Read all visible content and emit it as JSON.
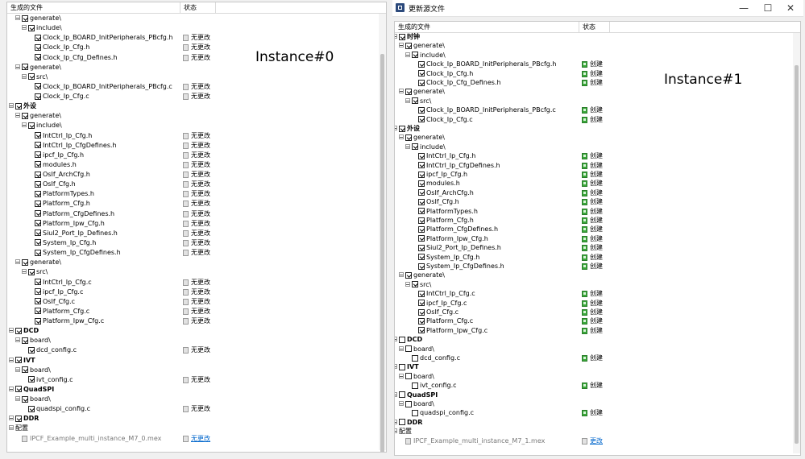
{
  "window1": {
    "title": "更新源文件",
    "minimize_glyph": "—",
    "maximize_glyph": "☐",
    "close_glyph": "✕"
  },
  "columns": {
    "file": "生成的文件",
    "status": "状态"
  },
  "panels": [
    {
      "caption": "Instance#0",
      "rows": [
        {
          "level": 1,
          "label": "generate\\",
          "checked": true
        },
        {
          "level": 2,
          "label": "include\\",
          "checked": true
        },
        {
          "level": 3,
          "label": "Clock_Ip_BOARD_InitPeripherals_PBcfg.h",
          "checked": true,
          "status": "无更改"
        },
        {
          "level": 3,
          "label": "Clock_Ip_Cfg.h",
          "checked": true,
          "status": "无更改"
        },
        {
          "level": 3,
          "label": "Clock_Ip_Cfg_Defines.h",
          "checked": true,
          "status": "无更改"
        },
        {
          "level": 1,
          "label": "generate\\",
          "checked": true
        },
        {
          "level": 2,
          "label": "src\\",
          "checked": true
        },
        {
          "level": 3,
          "label": "Clock_Ip_BOARD_InitPeripherals_PBcfg.c",
          "checked": true,
          "status": "无更改"
        },
        {
          "level": 3,
          "label": "Clock_Ip_Cfg.c",
          "checked": true,
          "status": "无更改"
        },
        {
          "level": 0,
          "label": "外设",
          "checked": true,
          "bold": true
        },
        {
          "level": 1,
          "label": "generate\\",
          "checked": true
        },
        {
          "level": 2,
          "label": "include\\",
          "checked": true
        },
        {
          "level": 3,
          "label": "IntCtrl_Ip_Cfg.h",
          "checked": true,
          "status": "无更改"
        },
        {
          "level": 3,
          "label": "IntCtrl_Ip_CfgDefines.h",
          "checked": true,
          "status": "无更改"
        },
        {
          "level": 3,
          "label": "ipcf_Ip_Cfg.h",
          "checked": true,
          "status": "无更改"
        },
        {
          "level": 3,
          "label": "modules.h",
          "checked": true,
          "status": "无更改"
        },
        {
          "level": 3,
          "label": "OsIf_ArchCfg.h",
          "checked": true,
          "status": "无更改"
        },
        {
          "level": 3,
          "label": "OsIf_Cfg.h",
          "checked": true,
          "status": "无更改"
        },
        {
          "level": 3,
          "label": "PlatformTypes.h",
          "checked": true,
          "status": "无更改"
        },
        {
          "level": 3,
          "label": "Platform_Cfg.h",
          "checked": true,
          "status": "无更改"
        },
        {
          "level": 3,
          "label": "Platform_CfgDefines.h",
          "checked": true,
          "status": "无更改"
        },
        {
          "level": 3,
          "label": "Platform_Ipw_Cfg.h",
          "checked": true,
          "status": "无更改"
        },
        {
          "level": 3,
          "label": "Siul2_Port_Ip_Defines.h",
          "checked": true,
          "status": "无更改"
        },
        {
          "level": 3,
          "label": "System_Ip_Cfg.h",
          "checked": true,
          "status": "无更改"
        },
        {
          "level": 3,
          "label": "System_Ip_CfgDefines.h",
          "checked": true,
          "status": "无更改"
        },
        {
          "level": 1,
          "label": "generate\\",
          "checked": true
        },
        {
          "level": 2,
          "label": "src\\",
          "checked": true
        },
        {
          "level": 3,
          "label": "IntCtrl_Ip_Cfg.c",
          "checked": true,
          "status": "无更改"
        },
        {
          "level": 3,
          "label": "ipcf_Ip_Cfg.c",
          "checked": true,
          "status": "无更改"
        },
        {
          "level": 3,
          "label": "OsIf_Cfg.c",
          "checked": true,
          "status": "无更改"
        },
        {
          "level": 3,
          "label": "Platform_Cfg.c",
          "checked": true,
          "status": "无更改"
        },
        {
          "level": 3,
          "label": "Platform_Ipw_Cfg.c",
          "checked": true,
          "status": "无更改"
        },
        {
          "level": 0,
          "label": "DCD",
          "checked": true,
          "bold": true
        },
        {
          "level": 1,
          "label": "board\\",
          "checked": true
        },
        {
          "level": 2,
          "label": "dcd_config.c",
          "checked": true,
          "status": "无更改"
        },
        {
          "level": 0,
          "label": "IVT",
          "checked": true,
          "bold": true
        },
        {
          "level": 1,
          "label": "board\\",
          "checked": true
        },
        {
          "level": 2,
          "label": "ivt_config.c",
          "checked": true,
          "status": "无更改"
        },
        {
          "level": 0,
          "label": "QuadSPI",
          "checked": true,
          "bold": true
        },
        {
          "level": 1,
          "label": "board\\",
          "checked": true
        },
        {
          "level": 2,
          "label": "quadspi_config.c",
          "checked": true,
          "status": "无更改"
        },
        {
          "level": 0,
          "label": "DDR",
          "checked": true,
          "bold": true
        },
        {
          "level": 0,
          "label": "配置",
          "nocheck": true
        },
        {
          "level": 1,
          "label": "IPCF_Example_multi_instance_M7_0.mex",
          "gray": true,
          "status": "无更改",
          "status_link": true
        }
      ]
    },
    {
      "caption": "Instance#1",
      "rows": [
        {
          "level": 0,
          "label": "时钟",
          "checked": true,
          "bold": true
        },
        {
          "level": 1,
          "label": "generate\\",
          "checked": true
        },
        {
          "level": 2,
          "label": "include\\",
          "checked": true
        },
        {
          "level": 3,
          "label": "Clock_Ip_BOARD_InitPeripherals_PBcfg.h",
          "checked": true,
          "status": "创建"
        },
        {
          "level": 3,
          "label": "Clock_Ip_Cfg.h",
          "checked": true,
          "status": "创建"
        },
        {
          "level": 3,
          "label": "Clock_Ip_Cfg_Defines.h",
          "checked": true,
          "status": "创建"
        },
        {
          "level": 1,
          "label": "generate\\",
          "checked": true
        },
        {
          "level": 2,
          "label": "src\\",
          "checked": true
        },
        {
          "level": 3,
          "label": "Clock_Ip_BOARD_InitPeripherals_PBcfg.c",
          "checked": true,
          "status": "创建"
        },
        {
          "level": 3,
          "label": "Clock_Ip_Cfg.c",
          "checked": true,
          "status": "创建"
        },
        {
          "level": 0,
          "label": "外设",
          "checked": true,
          "bold": true
        },
        {
          "level": 1,
          "label": "generate\\",
          "checked": true
        },
        {
          "level": 2,
          "label": "include\\",
          "checked": true
        },
        {
          "level": 3,
          "label": "IntCtrl_Ip_Cfg.h",
          "checked": true,
          "status": "创建"
        },
        {
          "level": 3,
          "label": "IntCtrl_Ip_CfgDefines.h",
          "checked": true,
          "status": "创建"
        },
        {
          "level": 3,
          "label": "ipcf_Ip_Cfg.h",
          "checked": true,
          "status": "创建"
        },
        {
          "level": 3,
          "label": "modules.h",
          "checked": true,
          "status": "创建"
        },
        {
          "level": 3,
          "label": "OsIf_ArchCfg.h",
          "checked": true,
          "status": "创建"
        },
        {
          "level": 3,
          "label": "OsIf_Cfg.h",
          "checked": true,
          "status": "创建"
        },
        {
          "level": 3,
          "label": "PlatformTypes.h",
          "checked": true,
          "status": "创建"
        },
        {
          "level": 3,
          "label": "Platform_Cfg.h",
          "checked": true,
          "status": "创建"
        },
        {
          "level": 3,
          "label": "Platform_CfgDefines.h",
          "checked": true,
          "status": "创建"
        },
        {
          "level": 3,
          "label": "Platform_Ipw_Cfg.h",
          "checked": true,
          "status": "创建"
        },
        {
          "level": 3,
          "label": "Siul2_Port_Ip_Defines.h",
          "checked": true,
          "status": "创建"
        },
        {
          "level": 3,
          "label": "System_Ip_Cfg.h",
          "checked": true,
          "status": "创建"
        },
        {
          "level": 3,
          "label": "System_Ip_CfgDefines.h",
          "checked": true,
          "status": "创建"
        },
        {
          "level": 1,
          "label": "generate\\",
          "checked": true
        },
        {
          "level": 2,
          "label": "src\\",
          "checked": true
        },
        {
          "level": 3,
          "label": "IntCtrl_Ip_Cfg.c",
          "checked": true,
          "status": "创建"
        },
        {
          "level": 3,
          "label": "ipcf_Ip_Cfg.c",
          "checked": true,
          "status": "创建"
        },
        {
          "level": 3,
          "label": "OsIf_Cfg.c",
          "checked": true,
          "status": "创建"
        },
        {
          "level": 3,
          "label": "Platform_Cfg.c",
          "checked": true,
          "status": "创建"
        },
        {
          "level": 3,
          "label": "Platform_Ipw_Cfg.c",
          "checked": true,
          "status": "创建"
        },
        {
          "level": 0,
          "label": "DCD",
          "checked": false,
          "bold": true
        },
        {
          "level": 1,
          "label": "board\\",
          "checked": false
        },
        {
          "level": 2,
          "label": "dcd_config.c",
          "checked": false,
          "status": "创建"
        },
        {
          "level": 0,
          "label": "IVT",
          "checked": false,
          "bold": true
        },
        {
          "level": 1,
          "label": "board\\",
          "checked": false
        },
        {
          "level": 2,
          "label": "ivt_config.c",
          "checked": false,
          "status": "创建"
        },
        {
          "level": 0,
          "label": "QuadSPI",
          "checked": false,
          "bold": true
        },
        {
          "level": 1,
          "label": "board\\",
          "checked": false
        },
        {
          "level": 2,
          "label": "quadspi_config.c",
          "checked": false,
          "status": "创建"
        },
        {
          "level": 0,
          "label": "DDR",
          "checked": false,
          "bold": true
        },
        {
          "level": 0,
          "label": "配置",
          "nocheck": true
        },
        {
          "level": 1,
          "label": "IPCF_Example_multi_instance_M7_1.mex",
          "gray": true,
          "status": "更改",
          "status_link": true
        }
      ]
    }
  ]
}
